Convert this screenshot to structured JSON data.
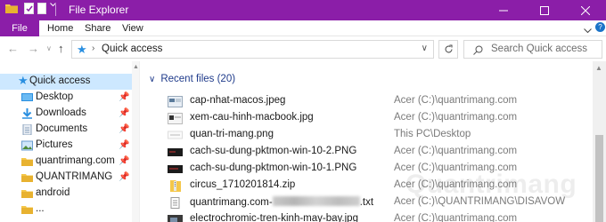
{
  "window": {
    "title": "File Explorer",
    "accent": "#8b1ea8"
  },
  "ribbon": {
    "tabs": [
      "File",
      "Home",
      "Share",
      "View"
    ]
  },
  "address": {
    "path_label": "Quick access",
    "search_placeholder": "Search Quick access"
  },
  "nav": {
    "items": [
      {
        "label": "Quick access",
        "icon": "star-icon",
        "pinned": false,
        "selected": true
      },
      {
        "label": "Desktop",
        "icon": "desktop-icon",
        "pinned": true
      },
      {
        "label": "Downloads",
        "icon": "download-icon",
        "pinned": true
      },
      {
        "label": "Documents",
        "icon": "documents-icon",
        "pinned": true
      },
      {
        "label": "Pictures",
        "icon": "pictures-icon",
        "pinned": true
      },
      {
        "label": "quantrimang.com",
        "icon": "folder-icon",
        "pinned": true
      },
      {
        "label": "QUANTRIMANG",
        "icon": "folder-icon",
        "pinned": true
      },
      {
        "label": "android",
        "icon": "folder-icon",
        "pinned": false
      },
      {
        "label": "...",
        "icon": "folder-icon",
        "pinned": false
      }
    ]
  },
  "recent": {
    "header": "Recent files (20)",
    "files": [
      {
        "name": "cap-nhat-macos.jpeg",
        "location": "Acer (C:)\\quantrimang.com",
        "thumb": "image-thumb"
      },
      {
        "name": "xem-cau-hinh-macbook.jpg",
        "location": "Acer (C:)\\quantrimang.com",
        "thumb": "image-thumb"
      },
      {
        "name": "quan-tri-mang.png",
        "location": "This PC\\Desktop",
        "thumb": "image-thumb"
      },
      {
        "name": "cach-su-dung-pktmon-win-10-2.PNG",
        "location": "Acer (C:)\\quantrimang.com",
        "thumb": "image-thumb"
      },
      {
        "name": "cach-su-dung-pktmon-win-10-1.PNG",
        "location": "Acer (C:)\\quantrimang.com",
        "thumb": "image-thumb"
      },
      {
        "name": "circus_1710201814.zip",
        "location": "Acer (C:)\\quantrimang.com",
        "thumb": "zip-icon"
      },
      {
        "name": "quantrimang.com-",
        "name_suffix": ".txt",
        "location": "Acer (C:)\\QUANTRIMANG\\DISAVOW",
        "thumb": "text-icon"
      },
      {
        "name": "electrochromic-tren-kinh-may-bay.jpg",
        "location": "Acer (C:)\\quantrimang.com",
        "thumb": "image-thumb"
      }
    ]
  },
  "watermark": "Quantrimang"
}
